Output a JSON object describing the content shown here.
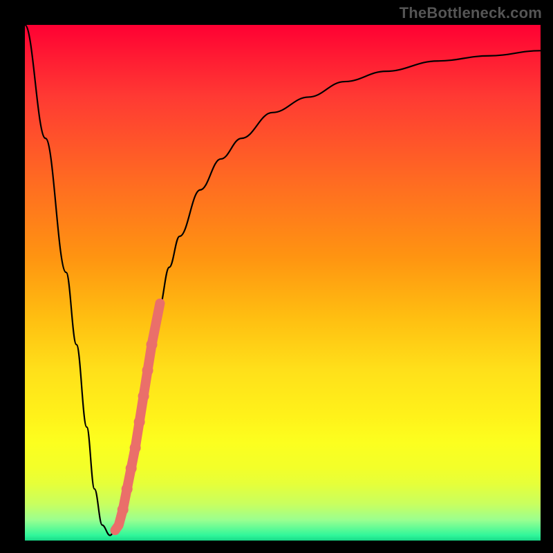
{
  "watermark": "TheBottleneck.com",
  "chart_data": {
    "type": "line",
    "title": "",
    "xlabel": "",
    "ylabel": "",
    "xlim": [
      0,
      100
    ],
    "ylim": [
      0,
      100
    ],
    "series": [
      {
        "name": "bottleneck-curve",
        "x": [
          0,
          4,
          8,
          10,
          12,
          13.5,
          15,
          16.5,
          18,
          20,
          22,
          24,
          26,
          28,
          30,
          34,
          38,
          42,
          48,
          55,
          62,
          70,
          80,
          90,
          100
        ],
        "values": [
          100,
          78,
          52,
          38,
          22,
          10,
          3,
          1,
          3,
          11,
          22,
          35,
          45,
          53,
          59,
          68,
          74,
          78,
          83,
          86,
          89,
          91,
          93,
          94,
          95
        ]
      }
    ],
    "markers": {
      "name": "highlight-segment",
      "color": "#ea6f6a",
      "points": [
        {
          "x": 17.5,
          "y": 2
        },
        {
          "x": 18.2,
          "y": 3
        },
        {
          "x": 19.0,
          "y": 6
        },
        {
          "x": 19.8,
          "y": 10
        },
        {
          "x": 20.6,
          "y": 14
        },
        {
          "x": 21.4,
          "y": 18
        },
        {
          "x": 22.2,
          "y": 23
        },
        {
          "x": 23.0,
          "y": 28
        },
        {
          "x": 23.8,
          "y": 33
        },
        {
          "x": 24.6,
          "y": 38
        },
        {
          "x": 25.4,
          "y": 42
        },
        {
          "x": 26.2,
          "y": 46
        }
      ]
    },
    "background_gradient": {
      "top_color": "#ff0033",
      "mid_color": "#ffe01a",
      "bottom_color": "#18d988"
    }
  }
}
